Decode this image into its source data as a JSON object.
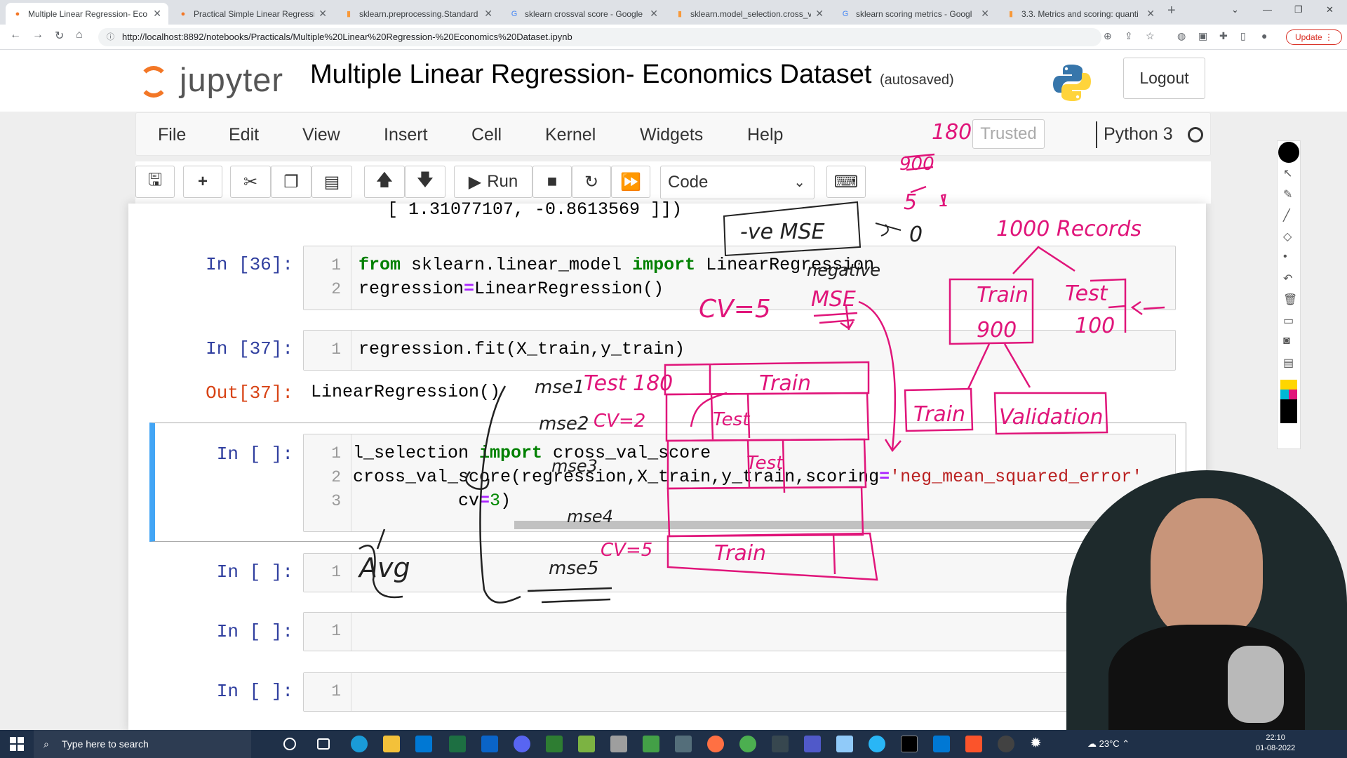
{
  "browser": {
    "tabs": [
      {
        "title": "Multiple Linear Regression- Eco",
        "icon": "jupyter-favicon",
        "active": true
      },
      {
        "title": "Practical Simple Linear Regressi",
        "icon": "jupyter-favicon",
        "active": false
      },
      {
        "title": "sklearn.preprocessing.Standard",
        "icon": "sklearn-favicon",
        "active": false
      },
      {
        "title": "sklearn crossval score - Google",
        "icon": "google-favicon",
        "active": false
      },
      {
        "title": "sklearn.model_selection.cross_v",
        "icon": "sklearn-favicon",
        "active": false
      },
      {
        "title": "sklearn scoring metrics - Googl",
        "icon": "google-favicon",
        "active": false
      },
      {
        "title": "3.3. Metrics and scoring: quanti",
        "icon": "sklearn-favicon",
        "active": false
      }
    ],
    "url": "http://localhost:8892/notebooks/Practicals/Multiple%20Linear%20Regression-%20Economics%20Dataset.ipynb",
    "update_label": "Update"
  },
  "jupyter": {
    "logo_text": "jupyter",
    "notebook_title": "Multiple Linear Regression- Economics Dataset",
    "autosave_status": "(autosaved)",
    "logout_label": "Logout",
    "menu": [
      "File",
      "Edit",
      "View",
      "Insert",
      "Cell",
      "Kernel",
      "Widgets",
      "Help"
    ],
    "trusted_label": "Trusted",
    "kernel_name": "Python 3",
    "toolbar": {
      "run_label": "Run",
      "cell_type": "Code"
    }
  },
  "notebook": {
    "previous_output": "[ 1.31077107, -0.8613569 ]])",
    "cells": [
      {
        "prompt": "In [36]:",
        "lines": [
          "1",
          "2"
        ],
        "code": [
          "from sklearn.linear_model import LinearRegression",
          "regression=LinearRegression()"
        ]
      },
      {
        "prompt": "In [37]:",
        "lines": [
          "1"
        ],
        "code": [
          "regression.fit(X_train,y_train)"
        ],
        "out_prompt": "Out[37]:",
        "output": "LinearRegression()"
      },
      {
        "prompt": "In [ ]:",
        "lines": [
          "1",
          "2",
          "3"
        ],
        "code": [
          "l_selection import cross_val_score",
          "cross_val_score(regression,X_train,y_train,scoring='neg_mean_squared_error'",
          "          cv=3)"
        ]
      },
      {
        "prompt": "In [ ]:",
        "lines": [
          "1"
        ],
        "code": [
          ""
        ]
      },
      {
        "prompt": "In [ ]:",
        "lines": [
          "1"
        ],
        "code": [
          ""
        ]
      },
      {
        "prompt": "In [ ]:",
        "lines": [
          "1"
        ],
        "code": [
          ""
        ]
      }
    ]
  },
  "annotations": {
    "note_180": "180",
    "note_900": "900",
    "note_5": "5",
    "note_1": "1",
    "ve_mse": "-ve MSE",
    "arrow_zero": "0",
    "negative": "negative",
    "mse": "MSE",
    "cv5": "CV=5",
    "records": "1000 Records",
    "train": "Train",
    "train_count": "900",
    "test": "Test",
    "test_count": "100",
    "validation": "Validation",
    "mse1": "mse1",
    "mse2": "mse2",
    "mse3": "mse3",
    "mse4": "mse4",
    "mse5": "mse5",
    "test_180": "Test 180",
    "cv2": "CV=2",
    "cv5b": "CV=5",
    "avg": "Avg"
  },
  "taskbar": {
    "search_placeholder": "Type here to search",
    "weather": "23°C",
    "date": "01-08-2022",
    "time": "22:10"
  },
  "colors": {
    "jupyter_orange": "#f37726",
    "annotation_pink": "#e0157a",
    "selected_cell_border": "#42a5f5",
    "prompt_in": "#303f9f",
    "prompt_out": "#d84315"
  }
}
